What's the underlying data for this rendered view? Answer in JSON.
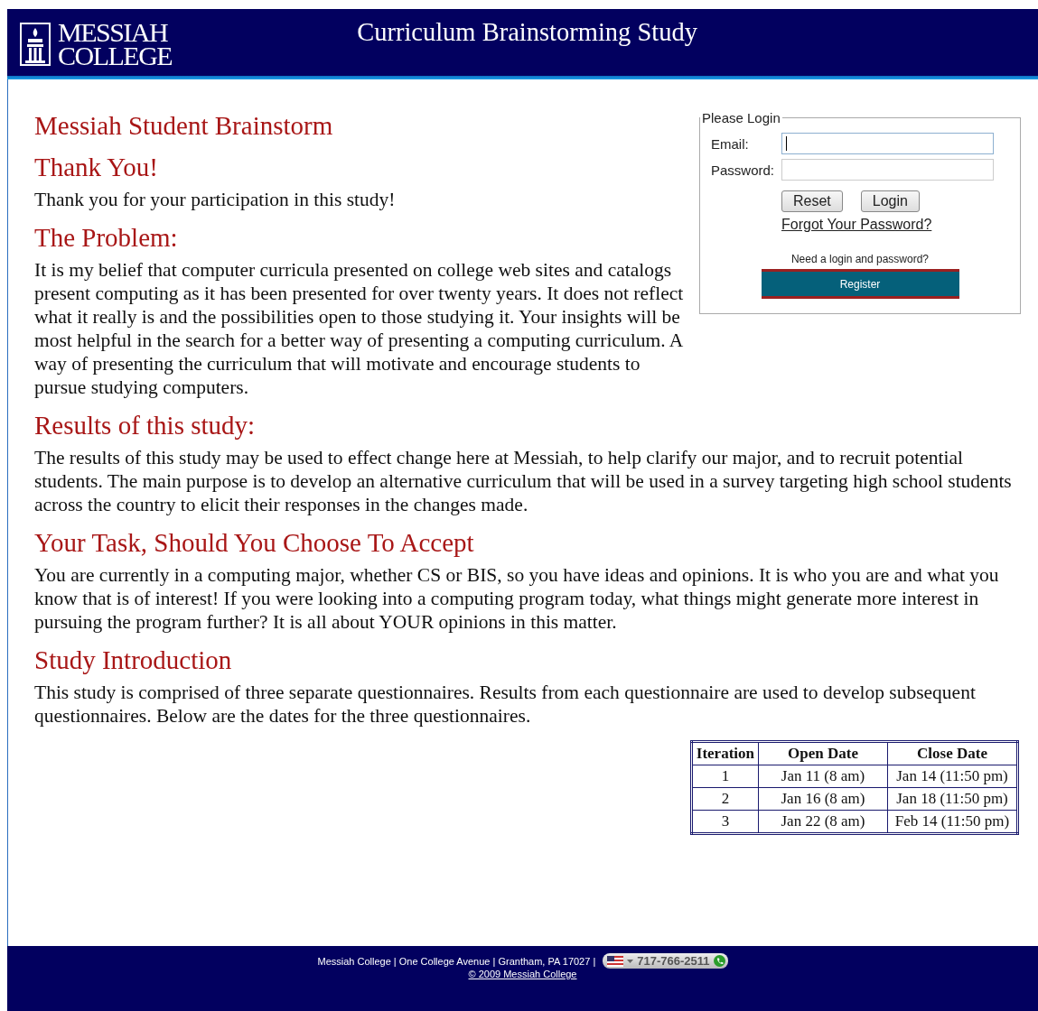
{
  "header": {
    "logo_lines": [
      "MESSIAH",
      "COLLEGE"
    ],
    "title": "Curriculum Brainstorming Study"
  },
  "page_title": "Messiah Student Brainstorm",
  "login": {
    "legend": "Please Login",
    "fields": [
      {
        "label": "Email:",
        "focused": true
      },
      {
        "label": "Password:",
        "focused": false
      }
    ],
    "buttons": [
      "Reset",
      "Login"
    ],
    "forgot_link": "Forgot Your Password?",
    "register_prompt": "Need a login and password?",
    "register_button": "Register"
  },
  "sections": [
    {
      "heading": "Thank You!",
      "paragraphs": [
        "Thank you for your participation in this study!"
      ]
    },
    {
      "heading": "The Problem:",
      "paragraphs": [
        "It is my belief that computer curricula presented on college web sites and catalogs present computing as it has been presented for over twenty years. It does not reflect what it really is and the possibilities open to those studying it. Your insights will be most helpful in the search for a better way of presenting a computing curriculum. A way of presenting the curriculum that will motivate and encourage students to pursue studying computers."
      ]
    },
    {
      "heading": "Results of this study:",
      "paragraphs": [
        "The results of this study may be used to effect change here at Messiah, to help clarify our major, and to recruit potential students. The main purpose is to develop an alternative curriculum that will be used in a survey targeting high school students across the country to elicit their responses in the changes made."
      ]
    },
    {
      "heading": "Your Task, Should You Choose To Accept",
      "paragraphs": [
        "You are currently in a computing major, whether CS or BIS, so you have ideas and opinions. It is who you are and what you know that is of interest! If you were looking into a computing program today, what things might generate more interest in pursuing the program further? It is all about YOUR opinions in this matter."
      ]
    },
    {
      "heading": "Study Introduction",
      "paragraphs": [
        "This study is comprised of three separate questionnaires. Results from each questionnaire are used to develop subsequent questionnaires. Below are the dates for the three questionnaires."
      ]
    }
  ],
  "schedule_table": {
    "columns": [
      "Iteration",
      "Open Date",
      "Close Date"
    ],
    "rows": [
      [
        "1",
        "Jan 11 (8 am)",
        "Jan 14 (11:50 pm)"
      ],
      [
        "2",
        "Jan 16 (8 am)",
        "Jan 18 (11:50 pm)"
      ],
      [
        "3",
        "Jan 22 (8 am)",
        "Feb 14 (11:50 pm)"
      ]
    ]
  },
  "footer": {
    "address": "Messiah College | One College Avenue | Grantham, PA 17027 |",
    "phone": "717-766-2511",
    "copyright": "© 2009 Messiah College"
  }
}
